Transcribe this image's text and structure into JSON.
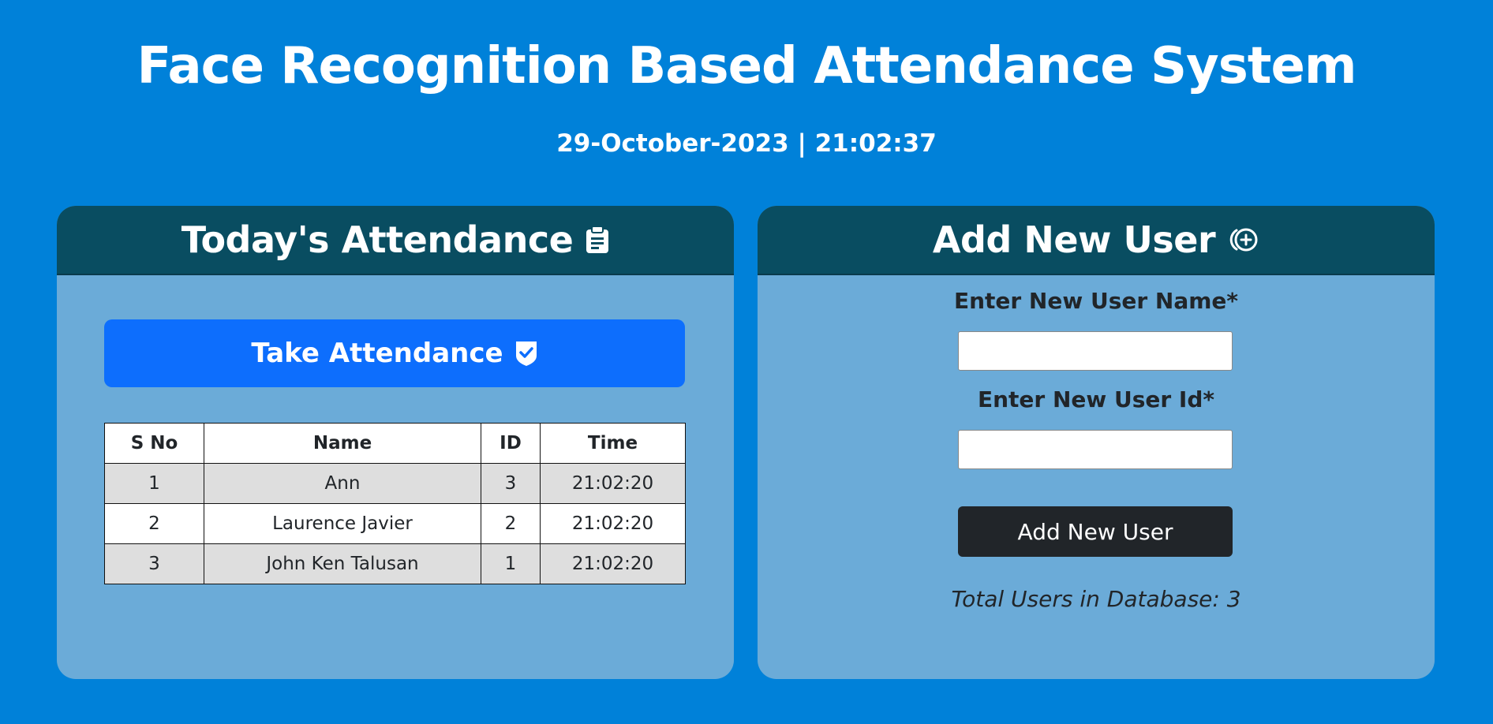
{
  "header": {
    "title": "Face Recognition Based Attendance System",
    "datetime": "29-October-2023 | 21:02:37"
  },
  "attendance": {
    "title": "Today's Attendance",
    "icon": "clipboard-icon",
    "take_button_label": "Take Attendance",
    "take_button_icon": "shield-check-icon",
    "columns": [
      "S No",
      "Name",
      "ID",
      "Time"
    ],
    "rows": [
      {
        "sno": "1",
        "name": "Ann",
        "id": "3",
        "time": "21:02:20"
      },
      {
        "sno": "2",
        "name": "Laurence Javier",
        "id": "2",
        "time": "21:02:20"
      },
      {
        "sno": "3",
        "name": "John Ken Talusan",
        "id": "1",
        "time": "21:02:20"
      }
    ]
  },
  "add_user": {
    "title": "Add New User",
    "icon": "person-add-icon",
    "name_label": "Enter New User Name*",
    "name_value": "",
    "id_label": "Enter New User Id*",
    "id_value": "",
    "submit_label": "Add New User",
    "total_users": "Total Users in Database: 3"
  },
  "colors": {
    "background": "#0081d9",
    "card_body": "#6babd8",
    "card_header": "#094d61",
    "primary_button": "#0d6efd",
    "dark_button": "#212529"
  }
}
